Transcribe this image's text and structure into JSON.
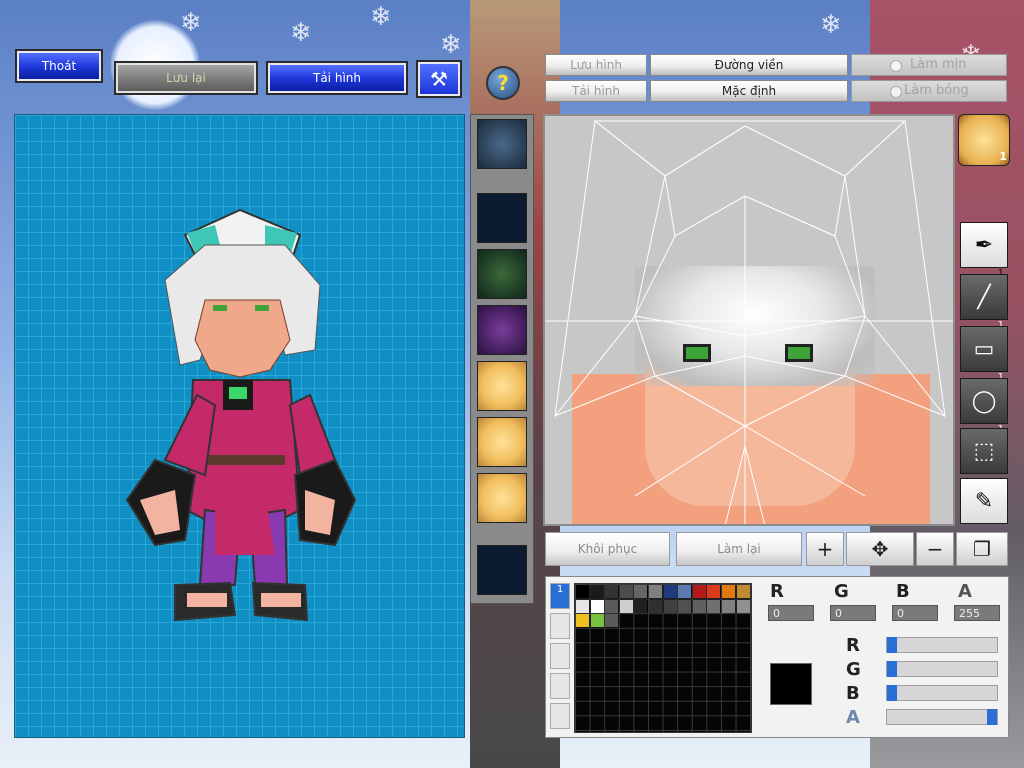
{
  "top_buttons": {
    "exit": "Thoát",
    "save": "Lưu lại",
    "reload_image": "Tải hình",
    "help_symbol": "?"
  },
  "tabs": {
    "save_image": "Lưu hình",
    "load_image": "Tải hình",
    "outline": "Đường viền",
    "default": "Mặc định"
  },
  "modes": {
    "smooth": "Làm mịn",
    "shade": "Làm bóng"
  },
  "actions": {
    "restore": "Khôi phục",
    "redo": "Làm lại"
  },
  "tools": [
    {
      "name": "pen",
      "count": "1"
    },
    {
      "name": "line",
      "count": "1"
    },
    {
      "name": "rectangle",
      "count": "1"
    },
    {
      "name": "ellipse",
      "count": "1"
    },
    {
      "name": "selection",
      "count": ""
    },
    {
      "name": "eyedropper",
      "count": ""
    }
  ],
  "avatar_count": "1",
  "color": {
    "r": "0",
    "g": "0",
    "b": "0",
    "a": "255",
    "current": "#000000",
    "alpha_fraction": 1.0
  },
  "palette_colors": [
    "#000000",
    "#1a1a1a",
    "#333333",
    "#4d4d4d",
    "#666666",
    "#808080",
    "#1f3a80",
    "#5a7ab0",
    "#b51a1a",
    "#d83a1a",
    "#e07a10",
    "#c08a30",
    "#e6e6e6",
    "#ffffff",
    "#5a5a5a",
    "#cfcfcf",
    "#202020",
    "#303030",
    "#404040",
    "#505050",
    "#606060",
    "#707070",
    "#808080",
    "#909090",
    "#f0c020",
    "#7ac040",
    "#5a5a5a"
  ],
  "palette_tab_active_label": "1"
}
